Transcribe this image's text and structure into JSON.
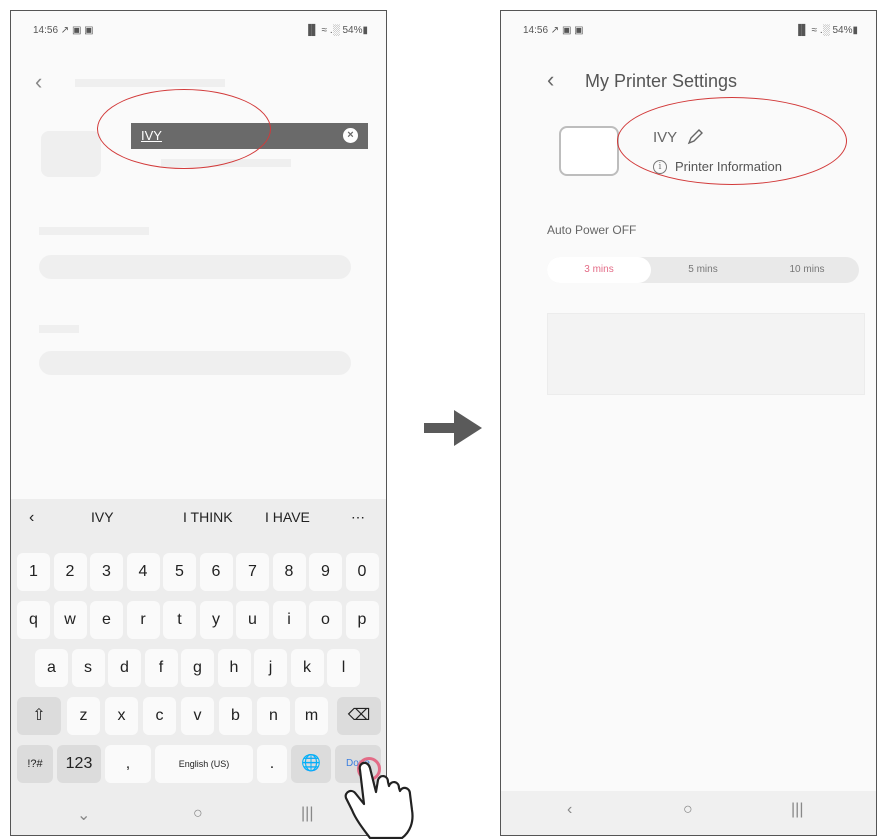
{
  "left_phone": {
    "status_time": "14:56 ↗ ▣ ▣",
    "status_right": "▐▌ ≈ .░ 54%▮",
    "edit_field_value": "IVY",
    "keyboard": {
      "suggestions": [
        "IVY",
        "I THINK",
        "I HAVE"
      ],
      "number_row": [
        "1",
        "2",
        "3",
        "4",
        "5",
        "6",
        "7",
        "8",
        "9",
        "0"
      ],
      "row1": [
        "q",
        "w",
        "e",
        "r",
        "t",
        "y",
        "u",
        "i",
        "o",
        "p"
      ],
      "row2": [
        "a",
        "s",
        "d",
        "f",
        "g",
        "h",
        "j",
        "k",
        "l"
      ],
      "row3": [
        "z",
        "x",
        "c",
        "v",
        "b",
        "n",
        "m"
      ],
      "symbols_label": "!?#",
      "numbers_label": "123",
      "comma_label": ",",
      "space_label": "English (US)",
      "period_label": ".",
      "done_label": "Done"
    }
  },
  "right_phone": {
    "status_time": "14:56 ↗ ▣ ▣",
    "status_right": "▐▌ ≈ .░ 54%▮",
    "title": "My Printer Settings",
    "printer_name": "IVY",
    "printer_info_label": "Printer Information",
    "auto_power_off_label": "Auto Power OFF",
    "power_options": [
      "3 mins",
      "5 mins",
      "10 mins"
    ],
    "selected_power_option": "3 mins"
  },
  "icons": [
    "back-icon",
    "pencil-icon",
    "info-icon",
    "clear-icon",
    "shift-icon",
    "backspace-icon",
    "globe-icon",
    "arrow-right-icon",
    "pointing-hand-icon"
  ],
  "colors": {
    "accent_pink": "#e36b86",
    "highlight_red": "#d23a3a"
  }
}
